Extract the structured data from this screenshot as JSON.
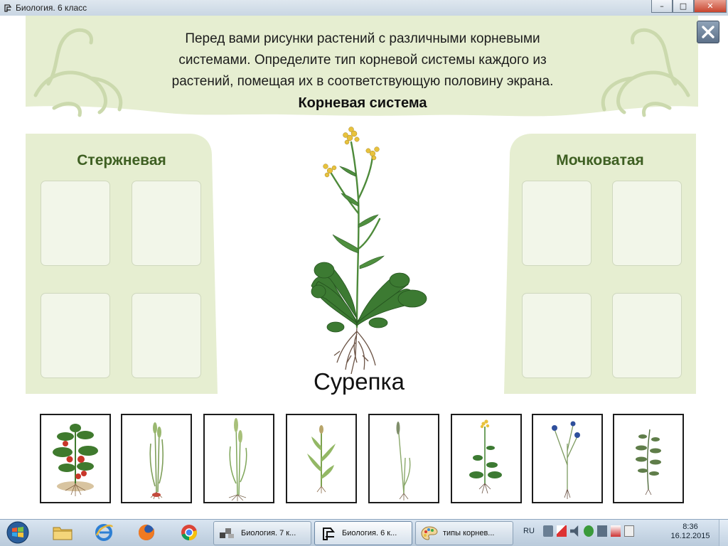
{
  "window": {
    "title": "Биология. 6 класс",
    "controls": [
      "minimize",
      "maximize",
      "close"
    ]
  },
  "header": {
    "instruction_lines": [
      "Перед вами рисунки растений с различными корневыми",
      "системами. Определите тип корневой системы  каждого из",
      "растений, помещая их в соответствующую половину экрана."
    ],
    "section_title": "Корневая система"
  },
  "left_panel": {
    "label": "Стержневая",
    "slots": 4
  },
  "right_panel": {
    "label": "Мочковатая",
    "slots": 4
  },
  "current_plant": {
    "name": "Сурепка"
  },
  "cards": [
    {
      "icon": "tomato-plant-icon"
    },
    {
      "icon": "grass-plant-icon"
    },
    {
      "icon": "wheat-plant-icon"
    },
    {
      "icon": "corn-plant-icon"
    },
    {
      "icon": "rye-plant-icon"
    },
    {
      "icon": "wintercress-plant-icon"
    },
    {
      "icon": "cornflower-plant-icon"
    },
    {
      "icon": "fern-plant-icon"
    }
  ],
  "taskbar": {
    "tasks": [
      {
        "label": "Биология. 7 к...",
        "active": false
      },
      {
        "label": "Биология. 6 к...",
        "active": true
      },
      {
        "label": "типы корнев...",
        "active": false
      }
    ],
    "language": "RU",
    "time": "8:36",
    "date": "16.12.2015"
  },
  "colors": {
    "panel_green": "#e6eed1",
    "label_green": "#3e5f22",
    "leaf_green": "#3c7a32",
    "flower_yellow": "#e8c23c"
  }
}
